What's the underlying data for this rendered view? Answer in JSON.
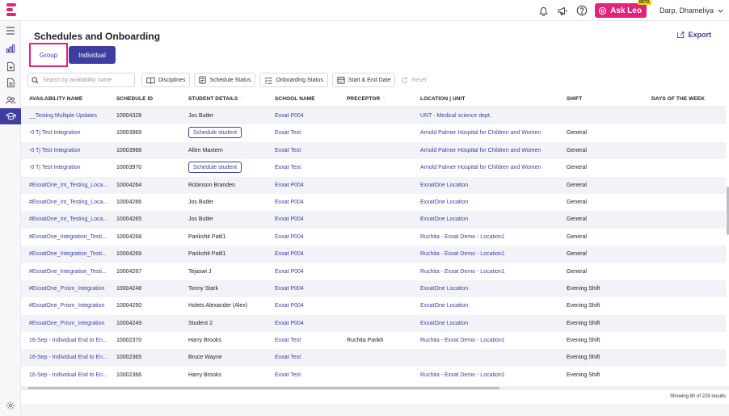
{
  "topbar": {
    "ask_leo_label": "Ask Leo",
    "beta_label": "BETA",
    "user_name": "Darp, Dhameliya"
  },
  "page": {
    "title": "Schedules and Onboarding",
    "export_label": "Export"
  },
  "toggle": {
    "group_label": "Group",
    "individual_label": "Individual"
  },
  "filters": {
    "search_placeholder": "Search by availability name",
    "disciplines_label": "Disciplines",
    "schedule_status_label": "Schedule Status",
    "onboarding_status_label": "Onboarding Status",
    "start_end_label": "Start & End Date",
    "reset_label": "Reset"
  },
  "table": {
    "headers": {
      "availability": "AVAILABILITY NAME",
      "schedule_id": "SCHEDULE ID",
      "student": "STUDENT DETAILS",
      "school": "SCHOOL NAME",
      "preceptor": "PRECEPTOR",
      "location": "LOCATION | UNIT",
      "shift": "SHIFT",
      "days": "DAYS OF THE WEEK"
    },
    "rows": [
      {
        "availability": "__Testing Multiple Updates",
        "schedule_id": "10004328",
        "student": "Jos Butler",
        "student_is_button": false,
        "school": "Exxat P004",
        "preceptor": "",
        "location": "UNT - Medical science dept.",
        "shift": ""
      },
      {
        "availability": "-0 Tj Test Integration",
        "schedule_id": "10003969",
        "student": "Schedule student",
        "student_is_button": true,
        "school": "Exxat Test",
        "preceptor": "",
        "location": "Arnold Palmer Hospital for Children and Women",
        "shift": "General"
      },
      {
        "availability": "-0 Tj Test Integration",
        "schedule_id": "10003968",
        "student": "Allen Maxtern",
        "student_is_button": false,
        "school": "Exxat Test",
        "preceptor": "",
        "location": "Arnold Palmer Hospital for Children and Women",
        "shift": "General"
      },
      {
        "availability": "-0 Tj Test Integration",
        "schedule_id": "10003970",
        "student": "Schedule student",
        "student_is_button": true,
        "school": "Exxat Test",
        "preceptor": "",
        "location": "Arnold Palmer Hospital for Children and Women",
        "shift": "General"
      },
      {
        "availability": "#ExxatOne_Int_Testing_Loca...",
        "schedule_id": "10004264",
        "student": "Robinson Branden",
        "student_is_button": false,
        "school": "Exxat P004",
        "preceptor": "",
        "location": "ExxatOne Location",
        "shift": "General"
      },
      {
        "availability": "#ExxatOne_Int_Testing_Loca...",
        "schedule_id": "10004266",
        "student": "Jos Butler",
        "student_is_button": false,
        "school": "Exxat P004",
        "preceptor": "",
        "location": "ExxatOne Location",
        "shift": "General"
      },
      {
        "availability": "#ExxatOne_Int_Testing_Loca...",
        "schedule_id": "10004265",
        "student": "Jos Butler",
        "student_is_button": false,
        "school": "Exxat P004",
        "preceptor": "",
        "location": "ExxatOne Location",
        "shift": "General"
      },
      {
        "availability": "#ExxatOne_Integration_Testi...",
        "schedule_id": "10004268",
        "student": "Parikshit Patil1",
        "student_is_button": false,
        "school": "Exxat P004",
        "preceptor": "",
        "location": "Ruchita - Exxat Demo - Location1",
        "shift": "General"
      },
      {
        "availability": "#ExxatOne_Integration_Testi...",
        "schedule_id": "10004269",
        "student": "Parikshit Patil1",
        "student_is_button": false,
        "school": "Exxat P004",
        "preceptor": "",
        "location": "Ruchita - Exxat Demo - Location1",
        "shift": "General"
      },
      {
        "availability": "#ExxatOne_Integration_Testi...",
        "schedule_id": "10004267",
        "student": "Tejaswi J",
        "student_is_button": false,
        "school": "Exxat P004",
        "preceptor": "",
        "location": "Ruchita - Exxat Demo - Location1",
        "shift": "General"
      },
      {
        "availability": "#ExxatOne_Prism_Integration",
        "schedule_id": "10004248",
        "student": "Tonny Stark",
        "student_is_button": false,
        "school": "Exxat P004",
        "preceptor": "",
        "location": "ExxatOne Location",
        "shift": "Evening Shift"
      },
      {
        "availability": "#ExxatOne_Prism_Integration",
        "schedule_id": "10004250",
        "student": "Holets Alexander (Alex)",
        "student_is_button": false,
        "school": "Exxat P004",
        "preceptor": "",
        "location": "ExxatOne Location",
        "shift": "Evening Shift"
      },
      {
        "availability": "#ExxatOne_Prism_Integration",
        "schedule_id": "10004249",
        "student": "Student 2",
        "student_is_button": false,
        "school": "Exxat P004",
        "preceptor": "",
        "location": "ExxatOne Location",
        "shift": "Evening Shift"
      },
      {
        "availability": "16-Sep - Individual End to En...",
        "schedule_id": "10002370",
        "student": "Harry Brooks",
        "student_is_button": false,
        "school": "Exxat Test",
        "preceptor": "Ruchita Parikh",
        "location": "Ruchita - Exxat Demo - Location1",
        "shift": "Evening Shift"
      },
      {
        "availability": "16-Sep - Individual End to En...",
        "schedule_id": "10002365",
        "student": "Bruce Wayne",
        "student_is_button": false,
        "school": "Exxat Test",
        "preceptor": "",
        "location": "",
        "shift": "Evening Shift"
      },
      {
        "availability": "16-Sep - Individual End to En...",
        "schedule_id": "10002366",
        "student": "Harry Brooks",
        "student_is_button": false,
        "school": "Exxat Test",
        "preceptor": "",
        "location": "Ruchita - Exxat Demo - Location1",
        "shift": "Evening Shift"
      }
    ]
  },
  "results_text": "Showing 80 of 229 results",
  "colors": {
    "brand_pink": "#e0247a",
    "brand_indigo": "#3d3f9e"
  }
}
